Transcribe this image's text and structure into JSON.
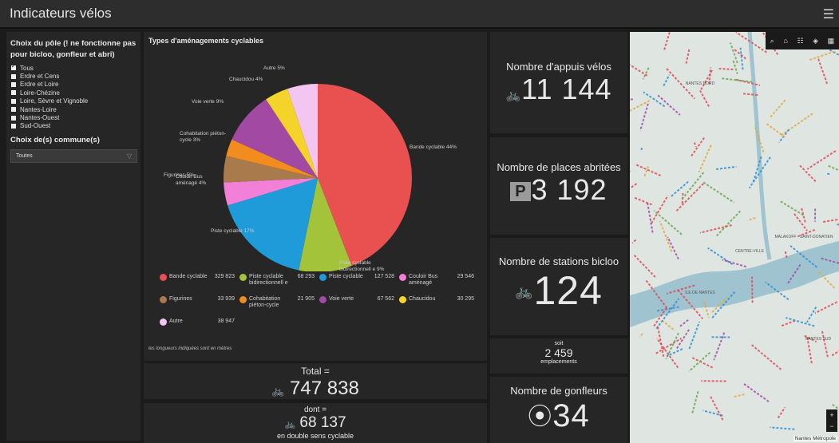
{
  "app": {
    "title": "Indicateurs vélos",
    "menu_icon": "hamburger-icon"
  },
  "filters": {
    "pole_title": "Choix du pôle (! ne fonctionne pas pour bicloo, gonfleur et abri)",
    "options": [
      {
        "label": "Tous",
        "checked": true
      },
      {
        "label": "Erdre et Cens",
        "checked": false
      },
      {
        "label": "Erdre et Loire",
        "checked": false
      },
      {
        "label": "Loire-Chézine",
        "checked": false
      },
      {
        "label": "Loire, Sèvre et Vignoble",
        "checked": false
      },
      {
        "label": "Nantes-Loire",
        "checked": false
      },
      {
        "label": "Nantes-Ouest",
        "checked": false
      },
      {
        "label": "Sud-Ouest",
        "checked": false
      }
    ],
    "commune_title": "Choix de(s) commune(s)",
    "commune_value": "Toutes"
  },
  "chart_data": {
    "type": "pie",
    "title": "Types d'aménagements cyclables",
    "slices": [
      {
        "name": "Bande cyclable",
        "value": 329823,
        "value_label": "329 823",
        "pie_label": "Bande cyclable 44%",
        "pct": 44,
        "color": "#e8514f"
      },
      {
        "name": "Piste cyclable bidirectionnelle",
        "value": 68293,
        "value_label": "68 293",
        "pie_label": "Piste cyclable bidirectionnell e 9%",
        "pct": 9,
        "color": "#a3c33a"
      },
      {
        "name": "Piste cyclable",
        "value": 127528,
        "value_label": "127 528",
        "pie_label": "Piste cyclable 17%",
        "pct": 17,
        "color": "#1e9bd8"
      },
      {
        "name": "Couloir Bus aménagé",
        "value": 29546,
        "value_label": "29 546",
        "pie_label": "Couloir Bus aménagé 4%",
        "pct": 4,
        "color": "#f27fd8"
      },
      {
        "name": "Figurines",
        "value": 33939,
        "value_label": "33 939",
        "pie_label": "Figurines 5%",
        "pct": 5,
        "color": "#a87a4c"
      },
      {
        "name": "Cohabitation piéton-cycle",
        "value": 21905,
        "value_label": "21 905",
        "pie_label": "Cohabitation piéton-cycle 3%",
        "pct": 3,
        "color": "#f28c1e"
      },
      {
        "name": "Voie verte",
        "value": 67562,
        "value_label": "67 562",
        "pie_label": "Voie verte 9%",
        "pct": 9,
        "color": "#a24aa3"
      },
      {
        "name": "Chaucidou",
        "value": 30295,
        "value_label": "30 295",
        "pie_label": "Chaucidou 4%",
        "pct": 4,
        "color": "#f4d32a"
      },
      {
        "name": "Autre",
        "value": 38947,
        "value_label": "38 947",
        "pie_label": "Autre 5%",
        "pct": 5,
        "color": "#f3c6f2"
      }
    ],
    "legend_labels": [
      "Bande cyclable",
      "Piste cyclable bidirectionnell e",
      "Piste cyclable",
      "Couloir Bus aménagé",
      "Figurines",
      "Cohabitation piéton-cycle",
      "Voie verte",
      "Chaucidou",
      "Autre"
    ],
    "note": "les longueurs indiquées sont en mètres"
  },
  "totals": {
    "total_label": "Total =",
    "total_value": "747 838",
    "dont_label": "dont =",
    "dont_value": "68 137",
    "dont_caption": "en double sens cyclable"
  },
  "kpis": {
    "appuis": {
      "label": "Nombre d'appuis vélos",
      "value": "11 144",
      "icon": "bike-rack-icon"
    },
    "abritees": {
      "label": "Nombre de places abritées",
      "value": "3 192",
      "icon": "parking-icon"
    },
    "bicloo": {
      "label": "Nombre de stations bicloo",
      "value": "124",
      "icon": "bike-station-icon"
    },
    "emplacements": {
      "pre": "soit",
      "value": "2 459",
      "post": "emplacements"
    },
    "gonfleurs": {
      "label": "Nombre de gonfleurs",
      "value": "34",
      "icon": "target-icon"
    }
  },
  "map": {
    "labels": [
      "NANTES NORD",
      "MALAKOFF - SAINT-DONATIEN",
      "CENTRE-VILLE",
      "ILE DE NANTES",
      "NANTES SUD"
    ],
    "credit": "Nantes Métropole",
    "zoom_in": "+",
    "zoom_out": "−",
    "water_color": "#9fc3cf",
    "route_color": "#e04a55"
  }
}
